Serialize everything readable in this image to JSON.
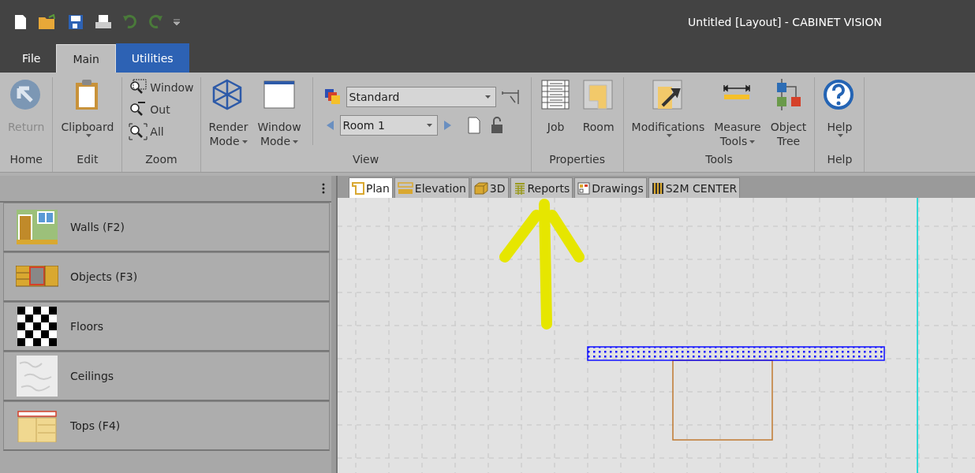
{
  "window": {
    "title": "Untitled [Layout] - CABINET VISION"
  },
  "menu_tabs": [
    {
      "label": "File",
      "selected": false,
      "kind": "plain"
    },
    {
      "label": "Main",
      "selected": true,
      "kind": "plain"
    },
    {
      "label": "Utilities",
      "selected": false,
      "kind": "accent"
    }
  ],
  "ribbon": {
    "groups": [
      {
        "label": "Home",
        "controls": [
          {
            "kind": "button",
            "label": "Return",
            "disabled": true
          }
        ]
      },
      {
        "label": "Edit",
        "controls": [
          {
            "kind": "splitbutton",
            "label": "Clipboard",
            "disabled": false
          }
        ]
      },
      {
        "label": "Zoom",
        "controls": [
          {
            "kind": "stack",
            "items": [
              "Window",
              "Out",
              "All"
            ]
          }
        ]
      },
      {
        "label": "View",
        "controls": [
          {
            "kind": "dropdown",
            "label": "Render Mode",
            "disabled": false
          },
          {
            "kind": "dropdown",
            "label": "Window Mode",
            "disabled": false
          },
          {
            "kind": "combos",
            "style": "Standard",
            "room": "Room 1"
          }
        ]
      },
      {
        "label": "Properties",
        "controls": [
          {
            "kind": "button",
            "label": "Job",
            "disabled": false
          },
          {
            "kind": "button",
            "label": "Room",
            "disabled": false
          }
        ]
      },
      {
        "label": "Tools",
        "controls": [
          {
            "kind": "splitbutton",
            "label": "Modifications",
            "disabled": false
          },
          {
            "kind": "dropdown",
            "label": "Measure Tools",
            "disabled": false
          },
          {
            "kind": "button",
            "label": "Object Tree",
            "disabled": false
          }
        ]
      },
      {
        "label": "Help",
        "controls": [
          {
            "kind": "splitbutton",
            "label": "Help",
            "disabled": false
          }
        ]
      }
    ]
  },
  "sidebar": {
    "items": [
      {
        "label": "Walls (F2)"
      },
      {
        "label": "Objects (F3)"
      },
      {
        "label": "Floors"
      },
      {
        "label": "Ceilings"
      },
      {
        "label": "Tops (F4)"
      }
    ]
  },
  "doc_tabs": [
    {
      "label": "Plan",
      "selected": true
    },
    {
      "label": "Elevation",
      "selected": false
    },
    {
      "label": "3D",
      "selected": false
    },
    {
      "label": "Reports",
      "selected": false
    },
    {
      "label": "Drawings",
      "selected": false
    },
    {
      "label": "S2M CENTER",
      "selected": false
    }
  ]
}
